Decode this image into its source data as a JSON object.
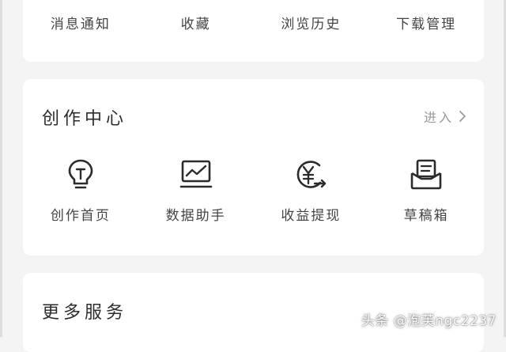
{
  "top_grid": {
    "items": [
      {
        "label": "消息通知"
      },
      {
        "label": "收藏"
      },
      {
        "label": "浏览历史"
      },
      {
        "label": "下载管理"
      }
    ]
  },
  "creation_center": {
    "title": "创作中心",
    "enter_label": "进入",
    "items": [
      {
        "label": "创作首页",
        "icon": "lightbulb-icon"
      },
      {
        "label": "数据助手",
        "icon": "line-chart-icon"
      },
      {
        "label": "收益提现",
        "icon": "yuan-withdraw-icon"
      },
      {
        "label": "草稿箱",
        "icon": "draft-box-icon"
      }
    ]
  },
  "more_services": {
    "title": "更多服务"
  },
  "watermark": "头条 @泡芙ngc2237",
  "colors": {
    "accent_red": "#e2353a",
    "icon_stroke": "#2b2b2b",
    "card_bg": "#ffffff",
    "page_bg": "#f4f4f4"
  }
}
